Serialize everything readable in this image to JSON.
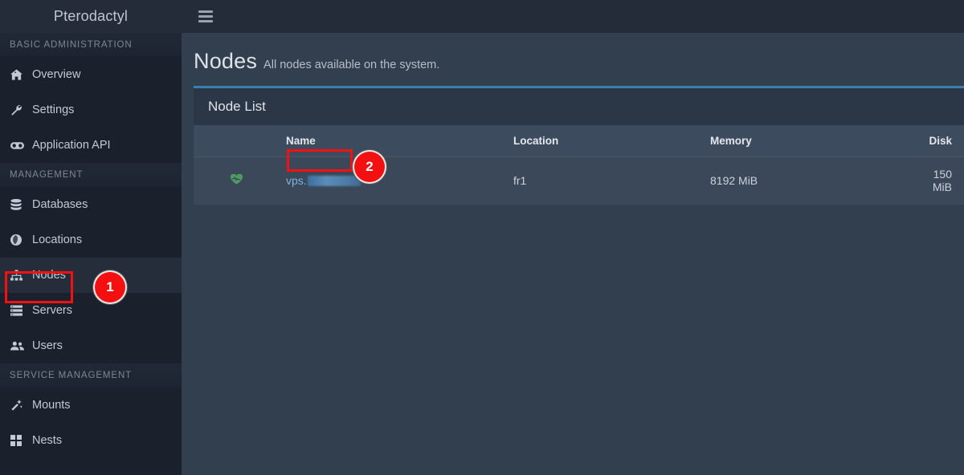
{
  "sidebar": {
    "brand": "Pterodactyl",
    "sections": [
      {
        "title": "BASIC ADMINISTRATION",
        "items": [
          {
            "label": "Overview",
            "icon": "home-icon",
            "active": false
          },
          {
            "label": "Settings",
            "icon": "wrench-icon",
            "active": false
          },
          {
            "label": "Application API",
            "icon": "gamepad-icon",
            "active": false
          }
        ]
      },
      {
        "title": "MANAGEMENT",
        "items": [
          {
            "label": "Databases",
            "icon": "database-icon",
            "active": false
          },
          {
            "label": "Locations",
            "icon": "globe-icon",
            "active": false
          },
          {
            "label": "Nodes",
            "icon": "sitemap-icon",
            "active": true
          },
          {
            "label": "Servers",
            "icon": "server-icon",
            "active": false
          },
          {
            "label": "Users",
            "icon": "users-icon",
            "active": false
          }
        ]
      },
      {
        "title": "SERVICE MANAGEMENT",
        "items": [
          {
            "label": "Mounts",
            "icon": "magic-wand-icon",
            "active": false
          },
          {
            "label": "Nests",
            "icon": "grid-icon",
            "active": false
          }
        ]
      }
    ]
  },
  "topbar": {
    "menu_icon": "hamburger-icon"
  },
  "page": {
    "title": "Nodes",
    "subtitle": "All nodes available on the system."
  },
  "card": {
    "title": "Node List"
  },
  "table": {
    "columns": [
      "",
      "Name",
      "Location",
      "Memory",
      "Disk"
    ],
    "rows": [
      {
        "status_icon": "heartbeat-icon",
        "name_prefix": "vps.",
        "name_redacted": true,
        "location": "fr1",
        "memory": "8192 MiB",
        "disk": "150 MiB"
      }
    ]
  },
  "annotations": {
    "markers": [
      {
        "number": "1",
        "target": "sidebar-item-nodes"
      },
      {
        "number": "2",
        "target": "node-name-link"
      }
    ]
  },
  "colors": {
    "accent": "#3a7fb0",
    "annotation": "#f41010",
    "sidebar_bg": "#1a202c",
    "main_bg": "#323f4e",
    "link": "#7fb4e0",
    "status_ok": "#4e9b62"
  }
}
